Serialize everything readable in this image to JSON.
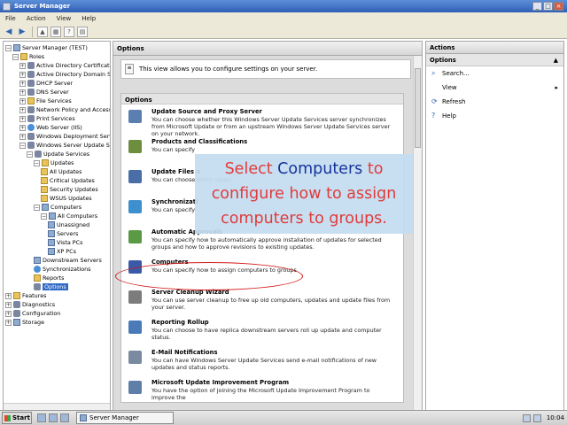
{
  "window": {
    "title": "Server Manager"
  },
  "menu": [
    "File",
    "Action",
    "View",
    "Help"
  ],
  "tree": [
    {
      "label": "Server Manager (TEST)",
      "level": 0,
      "exp": "-",
      "icon": "srv"
    },
    {
      "label": "Roles",
      "level": 1,
      "exp": "-",
      "icon": "folder"
    },
    {
      "label": "Active Directory Certificate",
      "level": 2,
      "exp": "+",
      "icon": "gear"
    },
    {
      "label": "Active Directory Domain Se",
      "level": 2,
      "exp": "+",
      "icon": "gear"
    },
    {
      "label": "DHCP Server",
      "level": 2,
      "exp": "+",
      "icon": "gear"
    },
    {
      "label": "DNS Server",
      "level": 2,
      "exp": "+",
      "icon": "gear"
    },
    {
      "label": "File Services",
      "level": 2,
      "exp": "+",
      "icon": "folder"
    },
    {
      "label": "Network Policy and Access",
      "level": 2,
      "exp": "+",
      "icon": "gear"
    },
    {
      "label": "Print Services",
      "level": 2,
      "exp": "+",
      "icon": "gear"
    },
    {
      "label": "Web Server (IIS)",
      "level": 2,
      "exp": "+",
      "icon": "globe"
    },
    {
      "label": "Windows Deployment Servi",
      "level": 2,
      "exp": "+",
      "icon": "gear"
    },
    {
      "label": "Windows Server Update Se",
      "level": 2,
      "exp": "-",
      "icon": "gear"
    },
    {
      "label": "Update Services",
      "level": 3,
      "exp": "-",
      "icon": "gear"
    },
    {
      "label": "Updates",
      "level": 4,
      "exp": "-",
      "icon": "folder"
    },
    {
      "label": "All Updates",
      "level": 5,
      "exp": "",
      "icon": "folder"
    },
    {
      "label": "Critical Updates",
      "level": 5,
      "exp": "",
      "icon": "folder"
    },
    {
      "label": "Security Updates",
      "level": 5,
      "exp": "",
      "icon": "folder"
    },
    {
      "label": "WSUS Updates",
      "level": 5,
      "exp": "",
      "icon": "folder"
    },
    {
      "label": "Computers",
      "level": 4,
      "exp": "-",
      "icon": "srv"
    },
    {
      "label": "All Computers",
      "level": 5,
      "exp": "-",
      "icon": "srv"
    },
    {
      "label": "Unassigned",
      "level": 6,
      "exp": "",
      "icon": "srv"
    },
    {
      "label": "Servers",
      "level": 6,
      "exp": "",
      "icon": "srv"
    },
    {
      "label": "Vista PCs",
      "level": 6,
      "exp": "",
      "icon": "srv"
    },
    {
      "label": "XP PCs",
      "level": 6,
      "exp": "",
      "icon": "srv"
    },
    {
      "label": "Downstream Servers",
      "level": 4,
      "exp": "",
      "icon": "srv"
    },
    {
      "label": "Synchronizations",
      "level": 4,
      "exp": "",
      "icon": "globe"
    },
    {
      "label": "Reports",
      "level": 4,
      "exp": "",
      "icon": "folder"
    },
    {
      "label": "Options",
      "level": 4,
      "exp": "",
      "icon": "gear",
      "selected": true
    },
    {
      "label": "Features",
      "level": 0,
      "exp": "+",
      "icon": "folder"
    },
    {
      "label": "Diagnostics",
      "level": 0,
      "exp": "+",
      "icon": "gear"
    },
    {
      "label": "Configuration",
      "level": 0,
      "exp": "+",
      "icon": "gear"
    },
    {
      "label": "Storage",
      "level": 0,
      "exp": "+",
      "icon": "srv"
    }
  ],
  "center": {
    "header": "Options",
    "info": "This view allows you to configure settings on your server.",
    "section": "Options",
    "options": [
      {
        "title": "Update Source and Proxy Server",
        "desc": "You can choose whether this Windows Server Update Services server synchronizes from Microsoft Update or from an upstream Windows Server Update Services server on your network.",
        "color": "#5b7fb0"
      },
      {
        "title": "Products and Classifications",
        "desc": "You can specify",
        "color": "#6d8e3f"
      },
      {
        "title": "Update Files a",
        "desc": "You can choose which updat",
        "color": "#4a6fa8"
      },
      {
        "title": "Synchronizati",
        "desc": "You can specify",
        "color": "#3d8fce"
      },
      {
        "title": "Automatic Approvals",
        "desc": "You can specify how to automatically approve installation of updates for selected groups and how to approve revisions to existing updates.",
        "color": "#5a9a45"
      },
      {
        "title": "Computers",
        "desc": "You can specify how to assign computers to groups.",
        "color": "#3a5aa8"
      },
      {
        "title": "Server Cleanup Wizard",
        "desc": "You can use server cleanup to free up old computers, updates and update files from your server.",
        "color": "#7c7c7c"
      },
      {
        "title": "Reporting Rollup",
        "desc": "You can choose to have replica downstream servers roll up update and computer status.",
        "color": "#4a7ab8"
      },
      {
        "title": "E-Mail Notifications",
        "desc": "You can have Windows Server Update Services send e-mail notifications of new updates and status reports.",
        "color": "#7a8aa0"
      },
      {
        "title": "Microsoft Update Improvement Program",
        "desc": "You have the option of joining the Microsoft Update Improvement Program to improve the",
        "color": "#5f7fa8"
      }
    ]
  },
  "callout": {
    "pre": "Select ",
    "highlight": "Computers",
    "post": " to configure how to assign computers to groups."
  },
  "actions": {
    "header": "Actions",
    "section": "Options",
    "items": [
      {
        "label": "Search...",
        "icon": "search-icon",
        "arrow": false
      },
      {
        "label": "View",
        "icon": "",
        "arrow": true
      },
      {
        "label": "Refresh",
        "icon": "refresh-icon",
        "arrow": false
      },
      {
        "label": "Help",
        "icon": "help-icon",
        "arrow": false
      }
    ]
  },
  "taskbar": {
    "start": "Start",
    "task": "Server Manager",
    "clock": "10:04"
  }
}
